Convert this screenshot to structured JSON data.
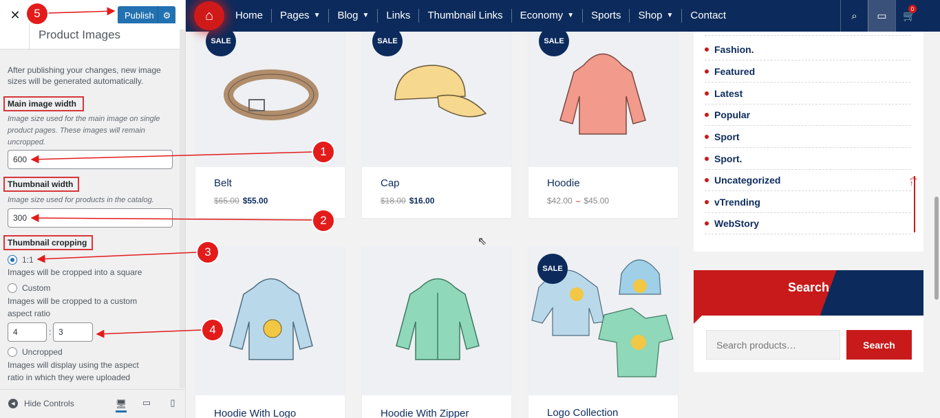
{
  "customizer": {
    "close_icon": "x-icon",
    "publish_label": "Publish",
    "section_title": "Product Images",
    "intro_text_1": "After publishing your changes, new image",
    "intro_text_2": "sizes will be generated automatically.",
    "main_image": {
      "label": "Main image width",
      "desc_1": "Image size used for the main image on single",
      "desc_2": "product pages. These images will remain",
      "desc_3": "uncropped.",
      "value": "600"
    },
    "thumbnail": {
      "label": "Thumbnail width",
      "desc": "Image size used for products in the catalog.",
      "value": "300"
    },
    "cropping": {
      "label": "Thumbnail cropping",
      "options": [
        {
          "label": "1:1",
          "desc": "Images will be cropped into a square",
          "selected": true
        },
        {
          "label": "Custom",
          "desc_1": "Images will be cropped to a custom",
          "desc_2": "aspect ratio",
          "selected": false
        },
        {
          "label": "Uncropped",
          "desc_1": "Images will display using the aspect",
          "desc_2": "ratio in which they were uploaded",
          "selected": false
        }
      ],
      "ratio_width": "4",
      "ratio_height": "3",
      "ratio_sep": ":"
    },
    "footer": {
      "hide_controls": "Hide Controls"
    }
  },
  "annotations": [
    "1",
    "2",
    "3",
    "4",
    "5"
  ],
  "navbar": {
    "items": [
      {
        "label": "Home"
      },
      {
        "label": "Pages"
      },
      {
        "label": "Blog"
      },
      {
        "label": "Links"
      },
      {
        "label": "Thumbnail Links"
      },
      {
        "label": "Economy"
      },
      {
        "label": "Sports"
      },
      {
        "label": "Shop"
      },
      {
        "label": "Contact"
      }
    ],
    "cart_count": "0"
  },
  "products": [
    {
      "name": "Belt",
      "sale": "SALE",
      "old_price": "$65.00",
      "price": "$55.00"
    },
    {
      "name": "Cap",
      "sale": "SALE",
      "old_price": "$18.00",
      "price": "$16.00"
    },
    {
      "name": "Hoodie",
      "sale": "SALE",
      "price_min": "$42.00",
      "price_sep": "–",
      "price_max": "$45.00"
    },
    {
      "name": "Hoodie With Logo"
    },
    {
      "name": "Hoodie With Zipper"
    },
    {
      "name": "Logo Collection",
      "sale": "SALE"
    }
  ],
  "categories": [
    "Fashion.",
    "Featured",
    "Latest",
    "Popular",
    "Sport",
    "Sport.",
    "Uncategorized",
    "vTrending",
    "WebStory"
  ],
  "search_widget": {
    "title": "Search",
    "placeholder": "Search products…",
    "button": "Search"
  },
  "colors": {
    "navy": "#0c2b5c",
    "red": "#c81a1a",
    "wp_blue": "#2271b1"
  }
}
